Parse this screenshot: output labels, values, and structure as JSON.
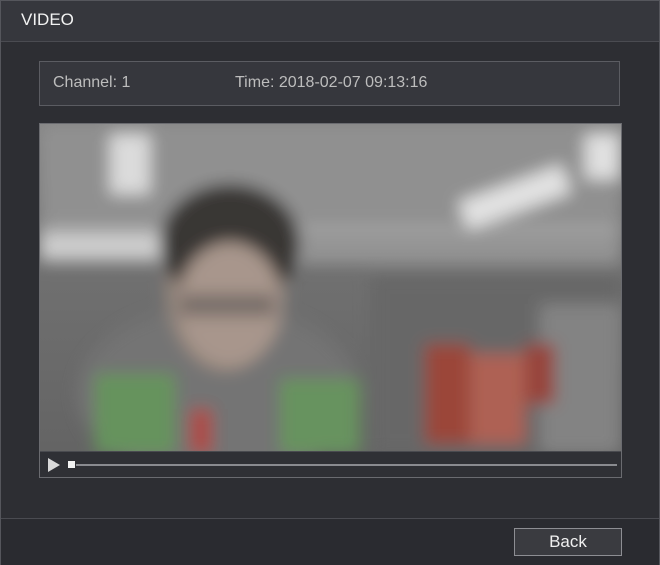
{
  "window": {
    "title": "VIDEO"
  },
  "info": {
    "channel": "Channel: 1",
    "time": "Time: 2018-02-07 09:13:16"
  },
  "player": {
    "progress": 0
  },
  "footer": {
    "back_label": "Back"
  }
}
